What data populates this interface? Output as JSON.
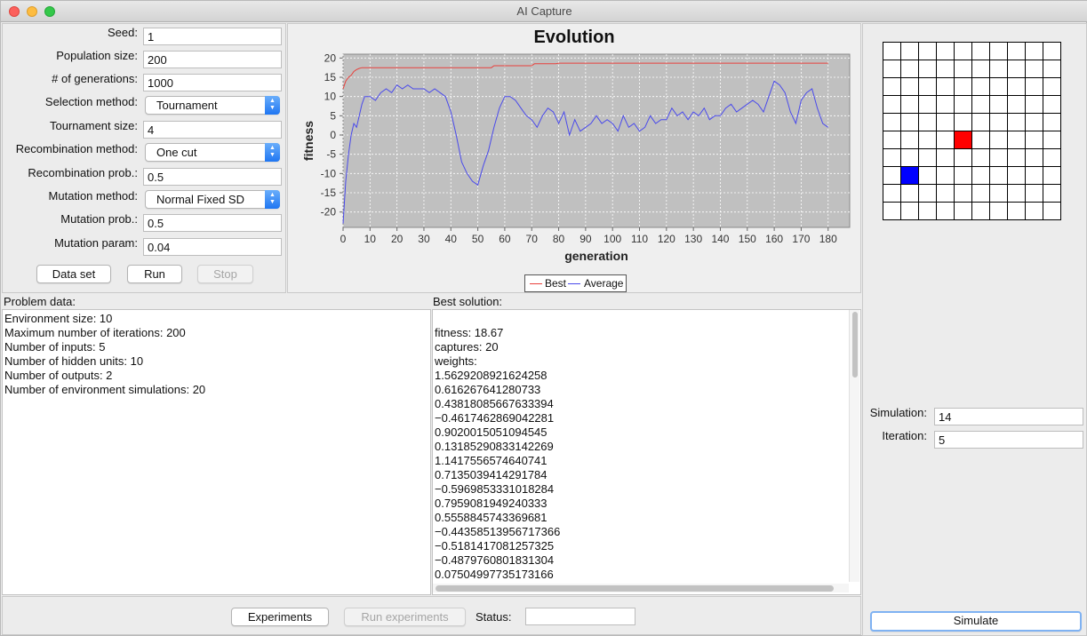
{
  "window": {
    "title": "AI Capture"
  },
  "params": [
    {
      "label": "Seed:",
      "value": "1",
      "kind": "field"
    },
    {
      "label": "Population size:",
      "value": "200",
      "kind": "field"
    },
    {
      "label": "# of generations:",
      "value": "1000",
      "kind": "field"
    },
    {
      "label": "Selection method:",
      "value": "Tournament",
      "kind": "combo"
    },
    {
      "label": "Tournament size:",
      "value": "4",
      "kind": "field"
    },
    {
      "label": "Recombination method:",
      "value": "One cut",
      "kind": "combo"
    },
    {
      "label": "Recombination prob.:",
      "value": "0.5",
      "kind": "field"
    },
    {
      "label": "Mutation method:",
      "value": "Normal Fixed SD",
      "kind": "combo"
    },
    {
      "label": "Mutation prob.:",
      "value": "0.5",
      "kind": "field"
    },
    {
      "label": "Mutation param:",
      "value": "0.04",
      "kind": "field"
    }
  ],
  "buttons": {
    "dataset": "Data set",
    "run": "Run",
    "stop": "Stop",
    "experiments": "Experiments",
    "run_experiments": "Run experiments",
    "simulate": "Simulate"
  },
  "status": {
    "label": "Status:",
    "value": ""
  },
  "chart_data": {
    "type": "line",
    "title": "Evolution",
    "xlabel": "generation",
    "ylabel": "fitness",
    "xlim": [
      0,
      188
    ],
    "ylim": [
      -24,
      21
    ],
    "xticks": [
      0,
      10,
      20,
      30,
      40,
      50,
      60,
      70,
      80,
      90,
      100,
      110,
      120,
      130,
      140,
      150,
      160,
      170,
      180
    ],
    "yticks": [
      20,
      15,
      10,
      5,
      0,
      -5,
      -10,
      -15,
      -20
    ],
    "grid": true,
    "legend_position": "bottom-center",
    "series": [
      {
        "name": "Best",
        "color": "#e8413c",
        "x": [
          0,
          1,
          2,
          3,
          4,
          5,
          6,
          7,
          55,
          56,
          70,
          71,
          79,
          80,
          180
        ],
        "y": [
          12,
          14,
          15,
          15.5,
          16.5,
          17,
          17.3,
          17.5,
          17.5,
          18,
          18,
          18.5,
          18.5,
          18.67,
          18.67
        ]
      },
      {
        "name": "Average",
        "color": "#4a4aeb",
        "x": [
          0,
          1,
          2,
          3,
          4,
          5,
          6,
          7,
          8,
          10,
          12,
          14,
          16,
          18,
          20,
          22,
          24,
          26,
          28,
          30,
          32,
          34,
          36,
          38,
          40,
          42,
          44,
          46,
          48,
          50,
          52,
          54,
          56,
          58,
          60,
          62,
          64,
          66,
          68,
          70,
          72,
          74,
          76,
          78,
          80,
          82,
          84,
          86,
          88,
          90,
          92,
          94,
          96,
          98,
          100,
          102,
          104,
          106,
          108,
          110,
          112,
          114,
          116,
          118,
          120,
          122,
          124,
          126,
          128,
          130,
          132,
          134,
          136,
          138,
          140,
          142,
          144,
          146,
          148,
          150,
          152,
          154,
          156,
          158,
          160,
          162,
          164,
          166,
          168,
          170,
          172,
          174,
          176,
          178,
          180
        ],
        "y": [
          -23,
          -12,
          -5,
          0,
          3,
          2,
          5,
          8,
          10,
          10,
          9,
          11,
          12,
          11,
          13,
          12,
          13,
          12,
          12,
          12,
          11,
          12,
          11,
          10,
          6,
          0,
          -7,
          -10,
          -12,
          -13,
          -8,
          -4,
          2,
          7,
          10,
          10,
          9,
          7,
          5,
          4,
          2,
          5,
          7,
          6,
          3,
          6,
          0,
          4,
          1,
          2,
          3,
          5,
          3,
          4,
          3,
          1,
          5,
          2,
          3,
          1,
          2,
          5,
          3,
          4,
          4,
          7,
          5,
          6,
          4,
          6,
          5,
          7,
          4,
          5,
          5,
          7,
          8,
          6,
          7,
          8,
          9,
          8,
          6,
          10,
          14,
          13,
          11,
          6,
          3,
          9,
          11,
          12,
          7,
          3,
          2
        ]
      }
    ]
  },
  "problem": {
    "title": "Problem data:",
    "lines": [
      "Environment size: 10",
      "Maximum number of iterations: 200",
      "Number of inputs: 5",
      "Number of hidden units: 10",
      "Number of outputs: 2",
      "Number of environment simulations: 20"
    ]
  },
  "solution": {
    "title": "Best solution:",
    "lines": [
      "",
      "fitness: 18.67",
      "captures: 20",
      "weights:",
      "1.5629208921624258",
      "0.616267641280733",
      "0.43818085667633394",
      "−0.4617462869042281",
      "0.9020015051094545",
      "0.13185290833142269",
      "1.1417556574640741",
      "0.7135039414291784",
      "−0.5969853331018284",
      "0.7959081949240333",
      "0.5558845743369681",
      "−0.44358513956717366",
      "−0.5181417081257325",
      "−0.4879760801831304",
      "0.07504997735173166"
    ]
  },
  "environment": {
    "size": 10,
    "red_cell": {
      "row": 5,
      "col": 4,
      "color": "#ff0000"
    },
    "blue_cell": {
      "row": 7,
      "col": 1,
      "color": "#0000ff"
    }
  },
  "sim": {
    "simulation_label": "Simulation:",
    "simulation_value": "14",
    "iteration_label": "Iteration:",
    "iteration_value": "5"
  }
}
